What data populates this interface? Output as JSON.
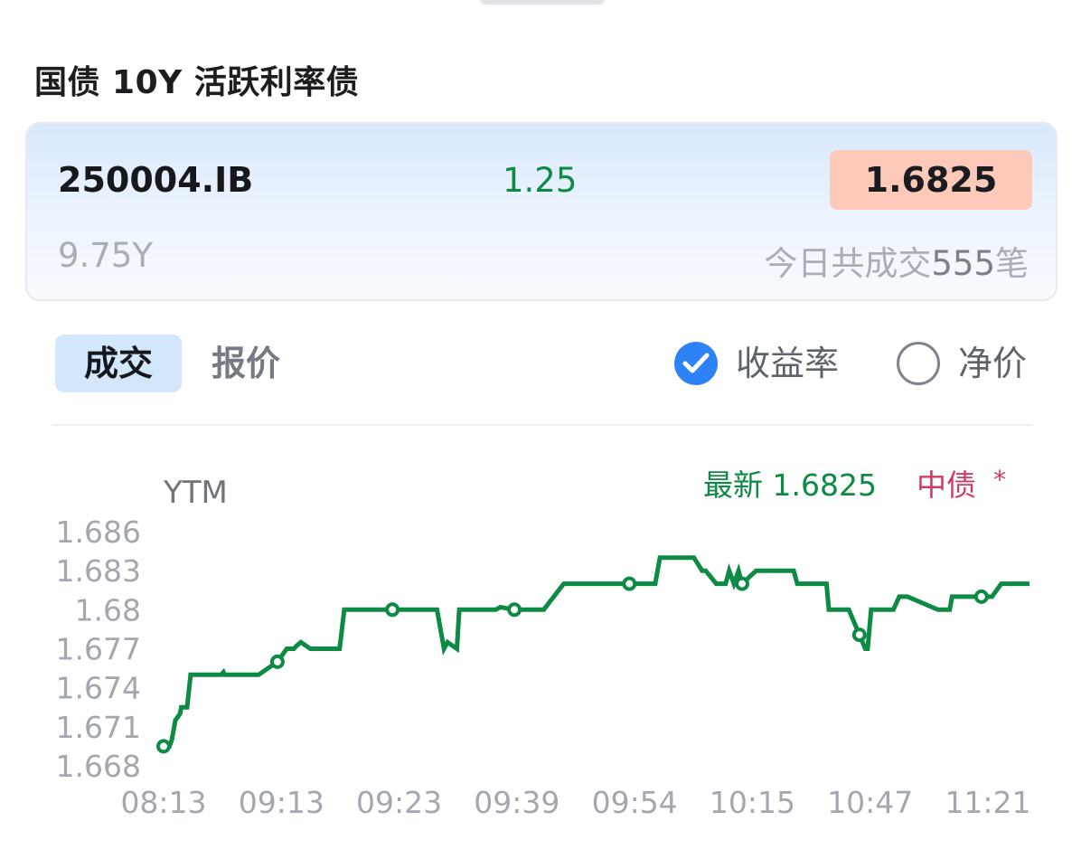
{
  "page_title": "国债 10Y 活跃利率债",
  "bond": {
    "code": "250004.IB",
    "coupon": "1.25",
    "latest_yield": "1.6825",
    "tenor": "9.75Y",
    "trade_count_prefix": "今日共成交",
    "trade_count": "555",
    "trade_count_suffix": "笔"
  },
  "tabs": [
    {
      "label": "成交",
      "active": true
    },
    {
      "label": "报价",
      "active": false
    }
  ],
  "display_options": [
    {
      "label": "收益率",
      "checked": true
    },
    {
      "label": "净价",
      "checked": false
    }
  ],
  "colors": {
    "line": "#0d8a44",
    "accent_blue": "#2d82f5",
    "yield_badge": "#fdc9b8",
    "source_label": "#d23a62"
  },
  "chart_data": {
    "type": "line",
    "ylabel": "YTM",
    "latest_label": "最新 1.6825",
    "source_label": "中债",
    "source_marker": "*",
    "x_ticks": [
      "08:13",
      "09:13",
      "09:23",
      "09:39",
      "09:54",
      "10:15",
      "10:47",
      "11:21"
    ],
    "y_ticks": [
      "1.686",
      "1.683",
      "1.68",
      "1.677",
      "1.674",
      "1.671",
      "1.668"
    ],
    "ylim": [
      1.668,
      1.686
    ],
    "series": [
      {
        "x": [
          0,
          0.5,
          0.7,
          0.8,
          1.0,
          1.4,
          1.5,
          2.0,
          2.3,
          3.5,
          4.9,
          5.1,
          5.2,
          5.5,
          5.9,
          6.4,
          7.0,
          8.1,
          9.7,
          10.5,
          11.0,
          11.1,
          11.3,
          11.7,
          12.5,
          15.0,
          15.4,
          18.9,
          19.1,
          19.5,
          20.0,
          21.0,
          21.6,
          21.8,
          22.2,
          22.5,
          23.3,
          23.9,
          24.2,
          25.0,
          25.2,
          25.5,
          26.3,
          28.3,
          28.7,
          29.9,
          31.0,
          32.4,
          34.1,
          37.1,
          37.5,
          39.7,
          41.0,
          41.9,
          42.3,
          42.5,
          45.2,
          45.9,
          46.2,
          47.1,
          47.9,
          48.2,
          48.6,
          49.0,
          49.3,
          50.5,
          52.5,
          53.7,
          54.0,
          54.2,
          56.5,
          56.7,
          57.3,
          57.5,
          58.0,
          58.4,
          59.8,
          60.0,
          60.3,
          61.0,
          61.1,
          61.4,
          61.7,
          62.2,
          62.7,
          63.4,
          66.0,
          66.3,
          67.0,
          67.2,
          68.0,
          70.0,
          70.3,
          70.6,
          71.4,
          72.1,
          72.4,
          73.0,
          73.8
        ],
        "y": [
          1.6695,
          1.6695,
          1.67,
          1.6705,
          1.6715,
          1.672,
          1.6725,
          1.6725,
          1.675,
          1.675,
          1.675,
          1.6752,
          1.675,
          1.675,
          1.675,
          1.675,
          1.675,
          1.675,
          1.676,
          1.677,
          1.677,
          1.677,
          1.6772,
          1.6775,
          1.677,
          1.677,
          1.68,
          1.68,
          1.68,
          1.68,
          1.68,
          1.68,
          1.68,
          1.68,
          1.68,
          1.68,
          1.68,
          1.677,
          1.6775,
          1.677,
          1.68,
          1.68,
          1.68,
          1.68,
          1.6802,
          1.68,
          1.68,
          1.68,
          1.682,
          1.682,
          1.682,
          1.682,
          1.682,
          1.682,
          1.684,
          1.684,
          1.684,
          1.683,
          1.683,
          1.682,
          1.682,
          1.683,
          1.682,
          1.683,
          1.682,
          1.683,
          1.683,
          1.683,
          1.682,
          1.682,
          1.682,
          1.68,
          1.68,
          1.68,
          1.68,
          1.68,
          1.677,
          1.677,
          1.68,
          1.68,
          1.68,
          1.68,
          1.68,
          1.68,
          1.681,
          1.681,
          1.68,
          1.68,
          1.68,
          1.681,
          1.681,
          1.681,
          1.681,
          1.681,
          1.682,
          1.682,
          1.682,
          1.682,
          1.682
        ],
        "markers_x": [
          0,
          9.7,
          19.5,
          29.9,
          39.7,
          49.3,
          59.3,
          69.7
        ]
      }
    ]
  }
}
